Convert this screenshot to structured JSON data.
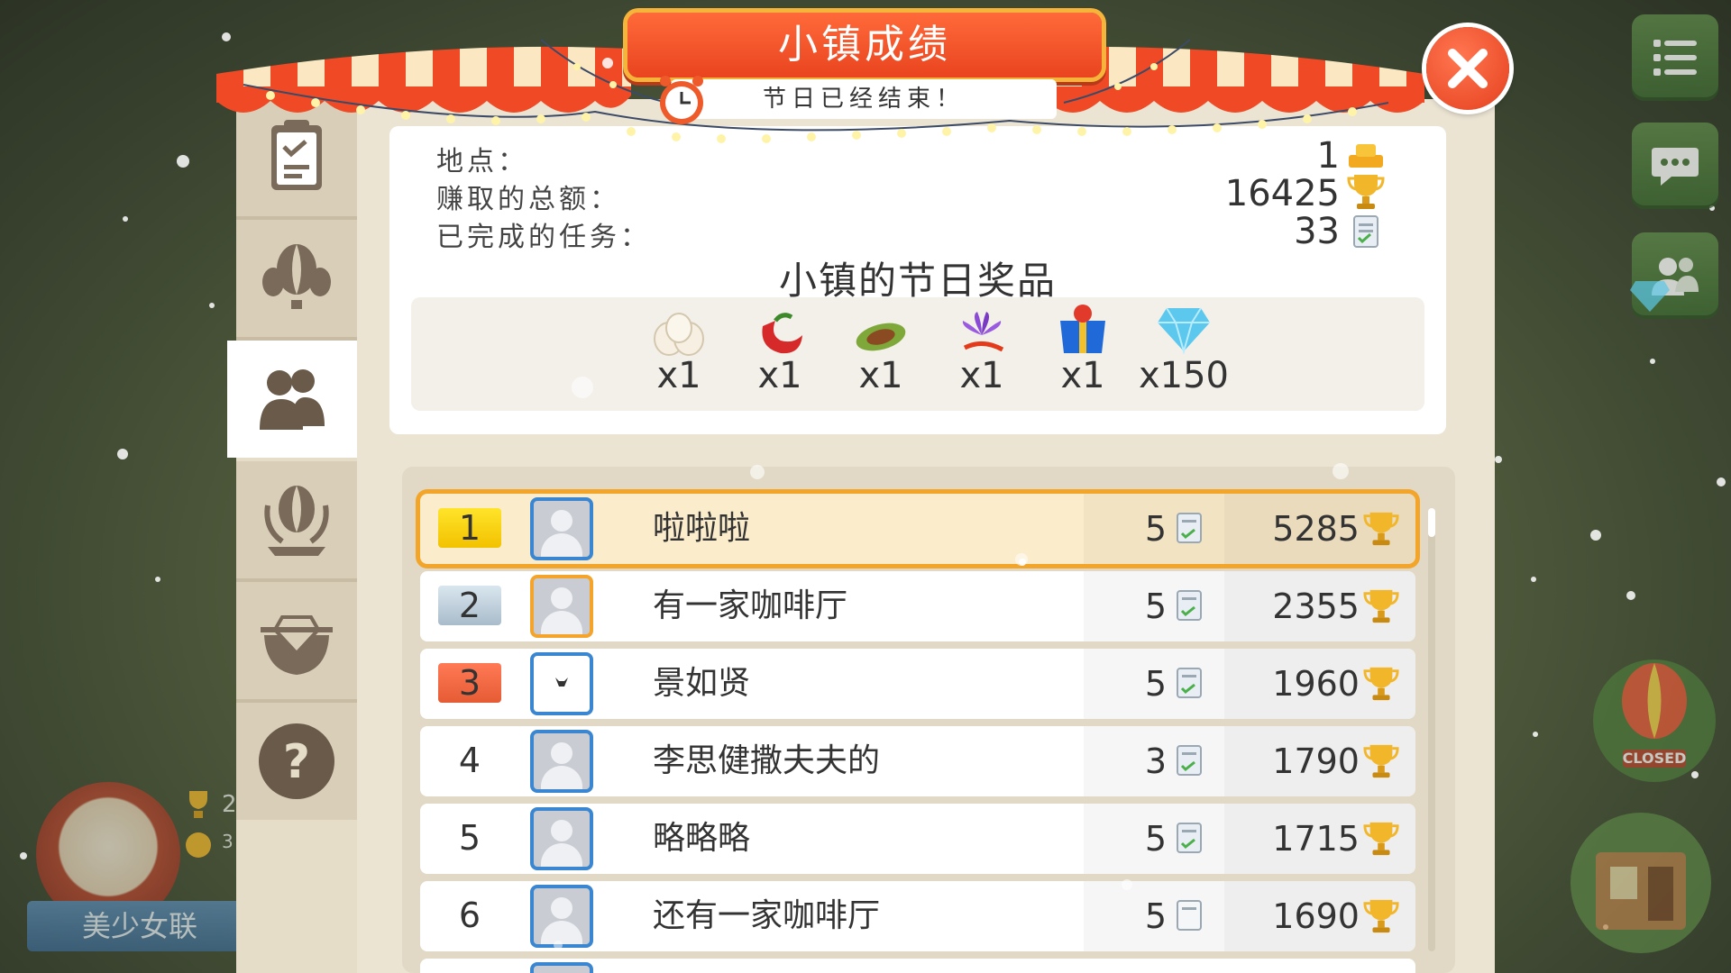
{
  "header": {
    "title": "小镇成绩",
    "subtitle": "节日已经结束！"
  },
  "stats": {
    "rank_label": "地点：",
    "rank_value": "1",
    "earned_label": "赚取的总额：",
    "earned_value": "16425",
    "tasks_label": "已完成的任务：",
    "tasks_value": "33"
  },
  "prizes": {
    "title": "小镇的节日奖品",
    "items": [
      {
        "icon": "eggs-icon",
        "qty": "x1"
      },
      {
        "icon": "red-pepper-icon",
        "qty": "x1"
      },
      {
        "icon": "cocoa-pod-icon",
        "qty": "x1"
      },
      {
        "icon": "saffron-flower-icon",
        "qty": "x1"
      },
      {
        "icon": "gift-bag-icon",
        "qty": "x1"
      },
      {
        "icon": "diamond-icon",
        "qty": "x150"
      }
    ]
  },
  "leaderboard": [
    {
      "rank": "1",
      "name": "啦啦啦",
      "tasks": "5",
      "points": "5285",
      "highlight": true
    },
    {
      "rank": "2",
      "name": "有一家咖啡厅",
      "tasks": "5",
      "points": "2355"
    },
    {
      "rank": "3",
      "name": "景如贤",
      "tasks": "5",
      "points": "1960"
    },
    {
      "rank": "4",
      "name": "李思健撒夫夫的",
      "tasks": "3",
      "points": "1790"
    },
    {
      "rank": "5",
      "name": "略略略",
      "tasks": "5",
      "points": "1715"
    },
    {
      "rank": "6",
      "name": "还有一家咖啡厅",
      "tasks": "5",
      "points": "1690"
    }
  ],
  "profile": {
    "name": "美少女联",
    "stat1": "2",
    "stat2": "3"
  },
  "hud": {
    "closed_label": "CLOSED"
  },
  "colors": {
    "accent": "#e9441f",
    "highlight": "#f3a52a",
    "avatar_border": "#3a86d0"
  }
}
